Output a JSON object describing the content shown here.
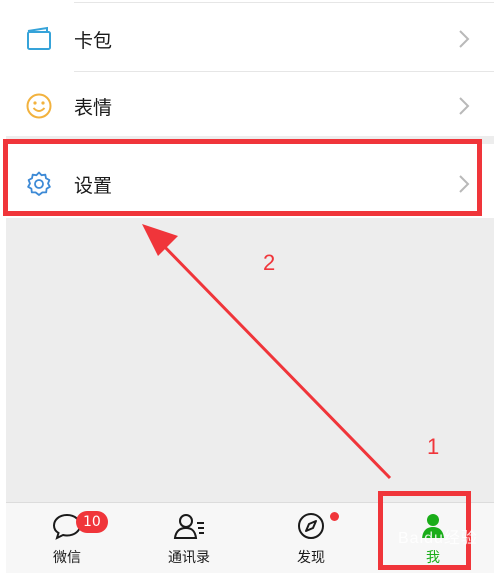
{
  "menu": {
    "items": [
      {
        "label": "卡包",
        "icon": "card-wallet-icon"
      },
      {
        "label": "表情",
        "icon": "smiley-icon"
      },
      {
        "label": "设置",
        "icon": "gear-icon"
      }
    ]
  },
  "annotations": {
    "step1": "1",
    "step2": "2",
    "color": "#f0353a"
  },
  "tabbar": {
    "tabs": [
      {
        "label": "微信",
        "icon": "chat-bubble-icon",
        "badge": "10"
      },
      {
        "label": "通讯录",
        "icon": "contacts-icon"
      },
      {
        "label": "发现",
        "icon": "compass-icon",
        "has_dot": true
      },
      {
        "label": "我",
        "icon": "me-icon",
        "active": true
      }
    ],
    "active_color": "#1aad19"
  },
  "watermark": "Baidu经验"
}
